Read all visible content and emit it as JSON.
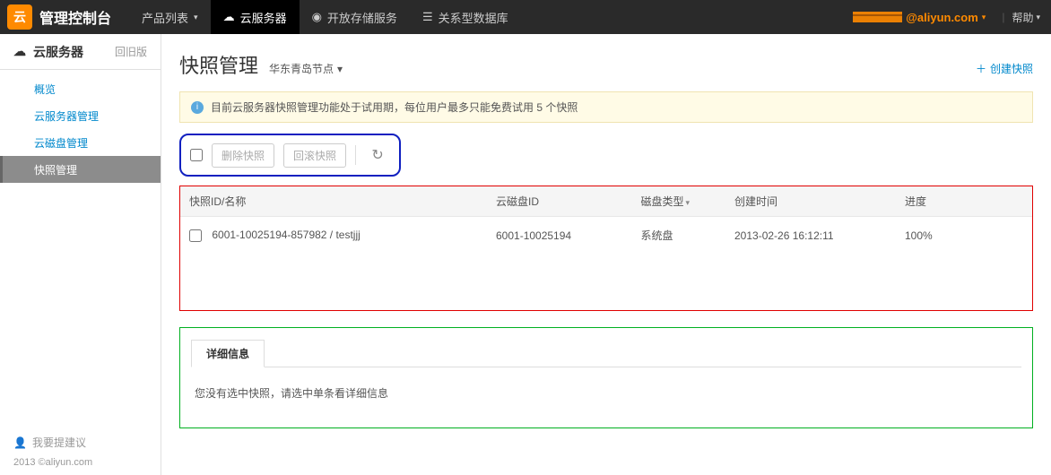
{
  "top": {
    "logo_glyph": "云",
    "console_name": "管理控制台",
    "nav": [
      {
        "label": "产品列表",
        "has_caret": true
      },
      {
        "label": "云服务器",
        "icon": "server"
      },
      {
        "label": "开放存储服务",
        "icon": "cloud"
      },
      {
        "label": "关系型数据库",
        "icon": "db"
      }
    ],
    "user_email_suffix": "@aliyun.com",
    "help_label": "帮助"
  },
  "sidebar": {
    "head_icon": "server",
    "head_label": "云服务器",
    "old_version_label": "回旧版",
    "items": [
      {
        "label": "概览"
      },
      {
        "label": "云服务器管理"
      },
      {
        "label": "云磁盘管理"
      },
      {
        "label": "快照管理",
        "active": true
      }
    ],
    "suggest_label": "我要提建议",
    "copyright": "2013 ©aliyun.com"
  },
  "page": {
    "title": "快照管理",
    "region": "华东青岛节点",
    "create_label": "创建快照",
    "notice": "目前云服务器快照管理功能处于试用期，每位用户最多只能免费试用 5 个快照"
  },
  "toolbar": {
    "delete_label": "删除快照",
    "rollback_label": "回滚快照"
  },
  "table": {
    "headers": {
      "id_name": "快照ID/名称",
      "disk_id": "云磁盘ID",
      "disk_type": "磁盘类型",
      "created": "创建时间",
      "progress": "进度"
    },
    "rows": [
      {
        "id_name": "6001-10025194-857982 / testjjj",
        "disk_id": "6001-10025194",
        "disk_type": "系统盘",
        "created": "2013-02-26 16:12:11",
        "progress": "100%"
      }
    ]
  },
  "detail": {
    "tab_label": "详细信息",
    "empty_message": "您没有选中快照，请选中单条看详细信息"
  }
}
